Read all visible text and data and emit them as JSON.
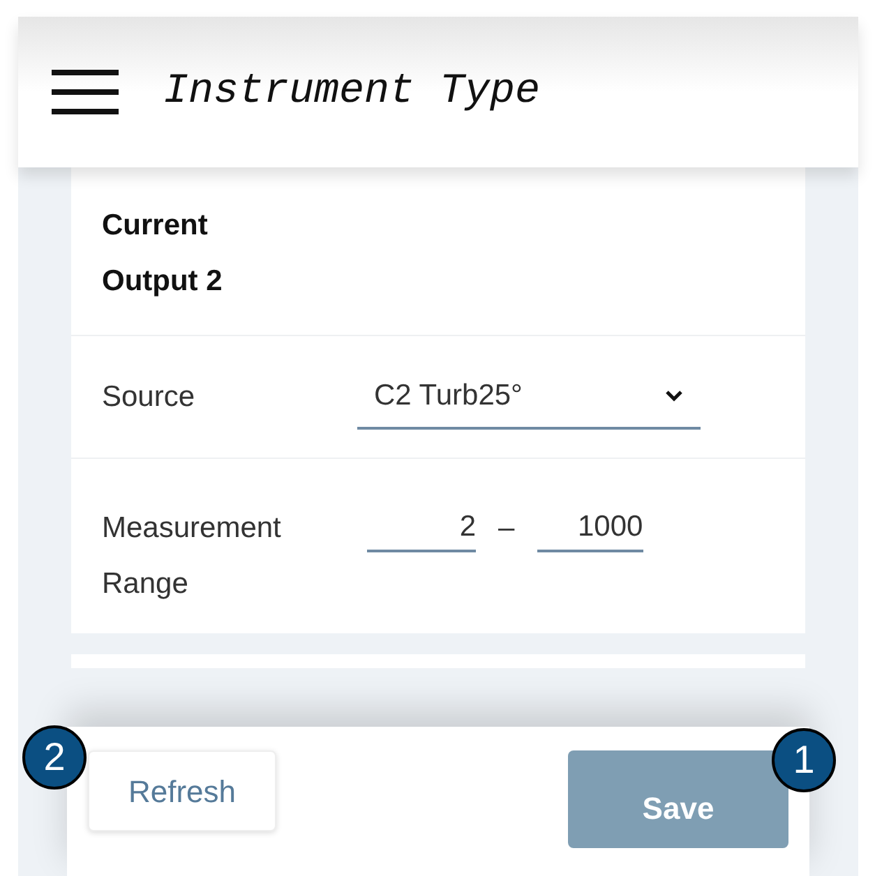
{
  "header": {
    "title": "Instrument Type"
  },
  "section": {
    "title": "Current Output 2"
  },
  "source": {
    "label": "Source",
    "value": "C2 Turb25°"
  },
  "range": {
    "label": "Measurement Range",
    "min": "2",
    "separator": "–",
    "max": "1000"
  },
  "buttons": [
    {
      "label": "Refresh",
      "kind": "secondary",
      "disabled": false,
      "callout": "2"
    },
    {
      "label": "Save",
      "kind": "primary",
      "disabled": true,
      "callout": "1"
    }
  ]
}
